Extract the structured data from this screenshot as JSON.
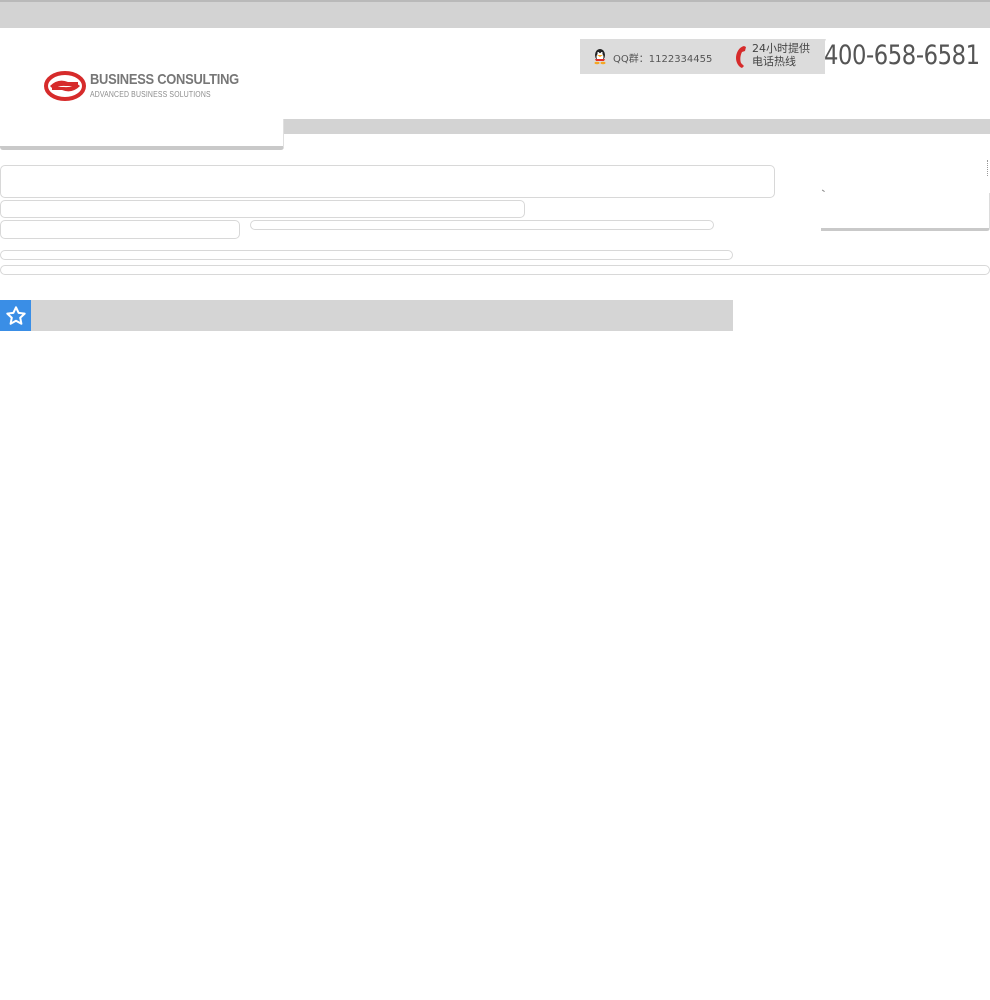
{
  "logo": {
    "title": "BUSINESS CONSULTING",
    "subtitle": "ADVANCED BUSINESS SOLUTIONS",
    "icon": "logo-mark-icon"
  },
  "contact": {
    "qq_label": "QQ群：1122334455",
    "hotline_line1": "24小时提供",
    "hotline_line2": "电话热线",
    "phone_number": "400-658-6581",
    "icons": [
      "qq-penguin-icon",
      "phone-handset-icon"
    ]
  },
  "section": {
    "icon": "star-icon"
  },
  "colors": {
    "accent_blue": "#3a8ee6",
    "logo_red": "#d62b2b",
    "bar_grey": "#d3d3d3"
  }
}
